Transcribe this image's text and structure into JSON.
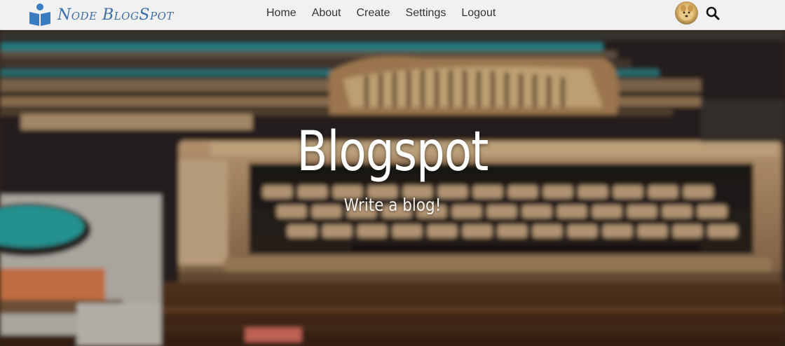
{
  "brand": {
    "name": "Node BlogSpot",
    "icon": "reader-book-icon",
    "color": "#3a6ea8"
  },
  "nav": {
    "items": [
      {
        "label": "Home"
      },
      {
        "label": "About"
      },
      {
        "label": "Create"
      },
      {
        "label": "Settings"
      },
      {
        "label": "Logout"
      }
    ]
  },
  "header_actions": {
    "avatar_icon": "user-avatar",
    "search_icon": "search-icon"
  },
  "hero": {
    "title": "Blogspot",
    "subtitle": "Write a blog!",
    "background": "blurred-vintage-typewriter-photo"
  }
}
